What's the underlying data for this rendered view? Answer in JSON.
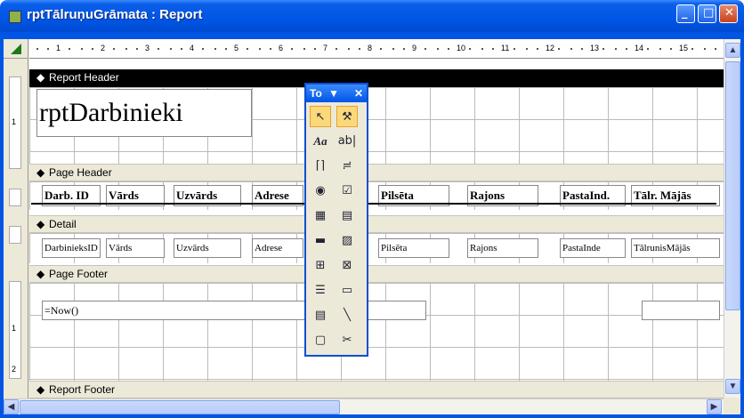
{
  "window": {
    "title": "rptTālruņuGrāmata : Report"
  },
  "title_buttons": {
    "minimize": "_",
    "maximize": "□",
    "close": "✕"
  },
  "ruler": {
    "numbers": [
      "1",
      "2",
      "3",
      "4",
      "5",
      "6",
      "7",
      "8",
      "9",
      "10",
      "11",
      "12",
      "13",
      "14",
      "15"
    ],
    "vertical": [
      "1",
      "1",
      "2"
    ]
  },
  "sections": {
    "report_header": "Report Header",
    "page_header": "Page Header",
    "detail": "Detail",
    "page_footer": "Page Footer",
    "report_footer": "Report Footer"
  },
  "report_title": "rptDarbinieki",
  "header_labels": [
    "Darb. ID",
    "Vārds",
    "Uzvārds",
    "Adrese",
    "Pilsēta",
    "Rajons",
    "PastaInd.",
    "Tālr. Mājās"
  ],
  "detail_fields": [
    "DarbinieksID",
    "Vārds",
    "Uzvārds",
    "Adrese",
    "Pilsēta",
    "Rajons",
    "PastaInde",
    "TālrunisMājās"
  ],
  "footer_field": "=Now()",
  "toolbox": {
    "title": "To",
    "dropdown": "▼",
    "close": "✕",
    "tools": [
      "select-objects",
      "control-wizards",
      "label",
      "text-box",
      "option-group",
      "toggle-button",
      "option-button",
      "check-box",
      "combo-box",
      "list-box",
      "command-button",
      "image",
      "unbound-object-frame",
      "bound-object-frame",
      "page-break",
      "tab-control",
      "subform-subreport",
      "line",
      "rectangle",
      "more-controls"
    ]
  }
}
